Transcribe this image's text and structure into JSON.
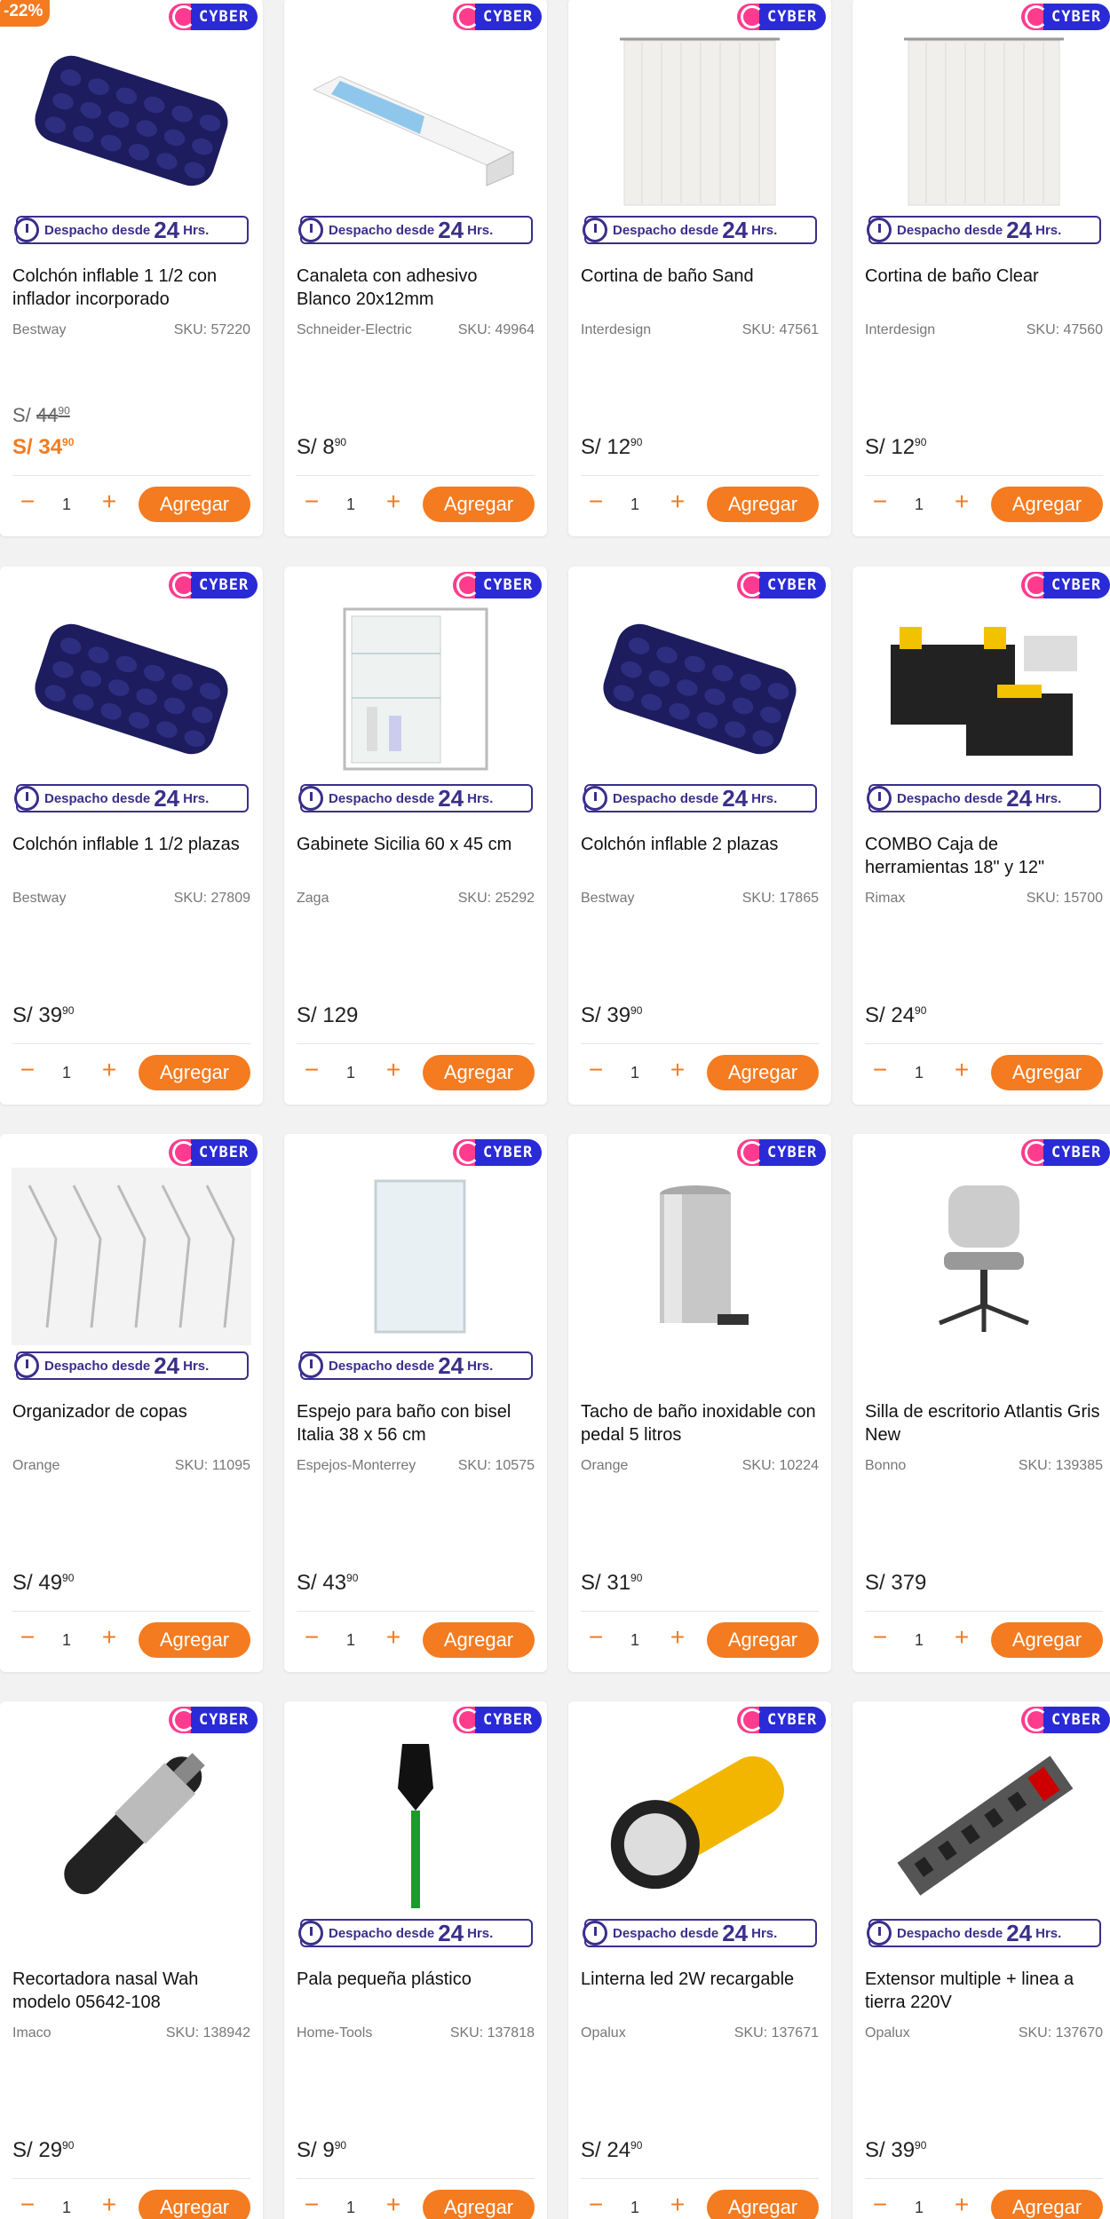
{
  "colors": {
    "accent": "#f47b20",
    "despacho": "#3a2f8a",
    "cyber_pink": "#ff3b8d",
    "cyber_blue": "#2a2bd6"
  },
  "badges": {
    "cyber": "CYBER",
    "despacho_prefix": "Despacho desde",
    "despacho_num": "24",
    "despacho_suffix": "Hrs."
  },
  "controls": {
    "minus": "−",
    "plus": "+",
    "add_label": "Agregar"
  },
  "currency": "S/",
  "products": [
    {
      "discount": "-22%",
      "name": "Colchón inflable 1 1/2 con inflador incorporado",
      "brand": "Bestway",
      "sku": "SKU: 57220",
      "old_int": "44",
      "old_dec": "90",
      "price_int": "34",
      "price_dec": "90",
      "sale": true,
      "qty": "1",
      "icon": "air-mattress-icon",
      "despacho": true
    },
    {
      "name": "Canaleta con adhesivo Blanco 20x12mm",
      "brand": "Schneider-Electric",
      "sku": "SKU: 49964",
      "price_int": "8",
      "price_dec": "90",
      "qty": "1",
      "icon": "cable-channel-icon",
      "despacho": true
    },
    {
      "name": "Cortina de baño Sand",
      "brand": "Interdesign",
      "sku": "SKU: 47561",
      "price_int": "12",
      "price_dec": "90",
      "qty": "1",
      "icon": "shower-curtain-icon",
      "despacho": true
    },
    {
      "name": "Cortina de baño Clear",
      "brand": "Interdesign",
      "sku": "SKU: 47560",
      "price_int": "12",
      "price_dec": "90",
      "qty": "1",
      "icon": "shower-curtain-icon",
      "despacho": true
    },
    {
      "name": "Colchón inflable 1 1/2 plazas",
      "brand": "Bestway",
      "sku": "SKU: 27809",
      "price_int": "39",
      "price_dec": "90",
      "qty": "1",
      "icon": "air-mattress-icon",
      "despacho": true
    },
    {
      "name": "Gabinete Sicilia 60 x 45 cm",
      "brand": "Zaga",
      "sku": "SKU: 25292",
      "price_int": "129",
      "price_dec": "",
      "qty": "1",
      "icon": "cabinet-icon",
      "despacho": true
    },
    {
      "name": "Colchón inflable 2 plazas",
      "brand": "Bestway",
      "sku": "SKU: 17865",
      "price_int": "39",
      "price_dec": "90",
      "qty": "1",
      "icon": "air-mattress-icon",
      "despacho": true
    },
    {
      "name": "COMBO Caja de herramientas 18\" y 12\"",
      "brand": "Rimax",
      "sku": "SKU: 15700",
      "price_int": "24",
      "price_dec": "90",
      "qty": "1",
      "icon": "toolbox-icon",
      "despacho": true
    },
    {
      "name": "Organizador de copas",
      "brand": "Orange",
      "sku": "SKU: 11095",
      "price_int": "49",
      "price_dec": "90",
      "qty": "1",
      "icon": "glass-rack-icon",
      "despacho": true
    },
    {
      "name": "Espejo para baño con bisel Italia 38 x 56 cm",
      "brand": "Espejos-Monterrey",
      "sku": "SKU: 10575",
      "price_int": "43",
      "price_dec": "90",
      "qty": "1",
      "icon": "mirror-icon",
      "despacho": true
    },
    {
      "name": "Tacho de baño inoxidable con pedal 5 litros",
      "brand": "Orange",
      "sku": "SKU: 10224",
      "price_int": "31",
      "price_dec": "90",
      "qty": "1",
      "icon": "trash-bin-icon",
      "despacho": false
    },
    {
      "name": "Silla de escritorio Atlantis Gris New",
      "brand": "Bonno",
      "sku": "SKU: 139385",
      "price_int": "379",
      "price_dec": "",
      "qty": "1",
      "icon": "office-chair-icon",
      "despacho": false
    },
    {
      "name": "Recortadora nasal Wah modelo 05642-108",
      "brand": "Imaco",
      "sku": "SKU: 138942",
      "price_int": "29",
      "price_dec": "90",
      "qty": "1",
      "icon": "nose-trimmer-icon",
      "despacho": false
    },
    {
      "name": "Pala pequeña plástico",
      "brand": "Home-Tools",
      "sku": "SKU: 137818",
      "price_int": "9",
      "price_dec": "90",
      "qty": "1",
      "icon": "shovel-icon",
      "despacho": true
    },
    {
      "name": "Linterna led 2W recargable",
      "brand": "Opalux",
      "sku": "SKU: 137671",
      "price_int": "24",
      "price_dec": "90",
      "qty": "1",
      "icon": "flashlight-icon",
      "despacho": true
    },
    {
      "name": "Extensor multiple + linea a tierra 220V",
      "brand": "Opalux",
      "sku": "SKU: 137670",
      "price_int": "39",
      "price_dec": "90",
      "qty": "1",
      "icon": "power-strip-icon",
      "despacho": true
    }
  ]
}
